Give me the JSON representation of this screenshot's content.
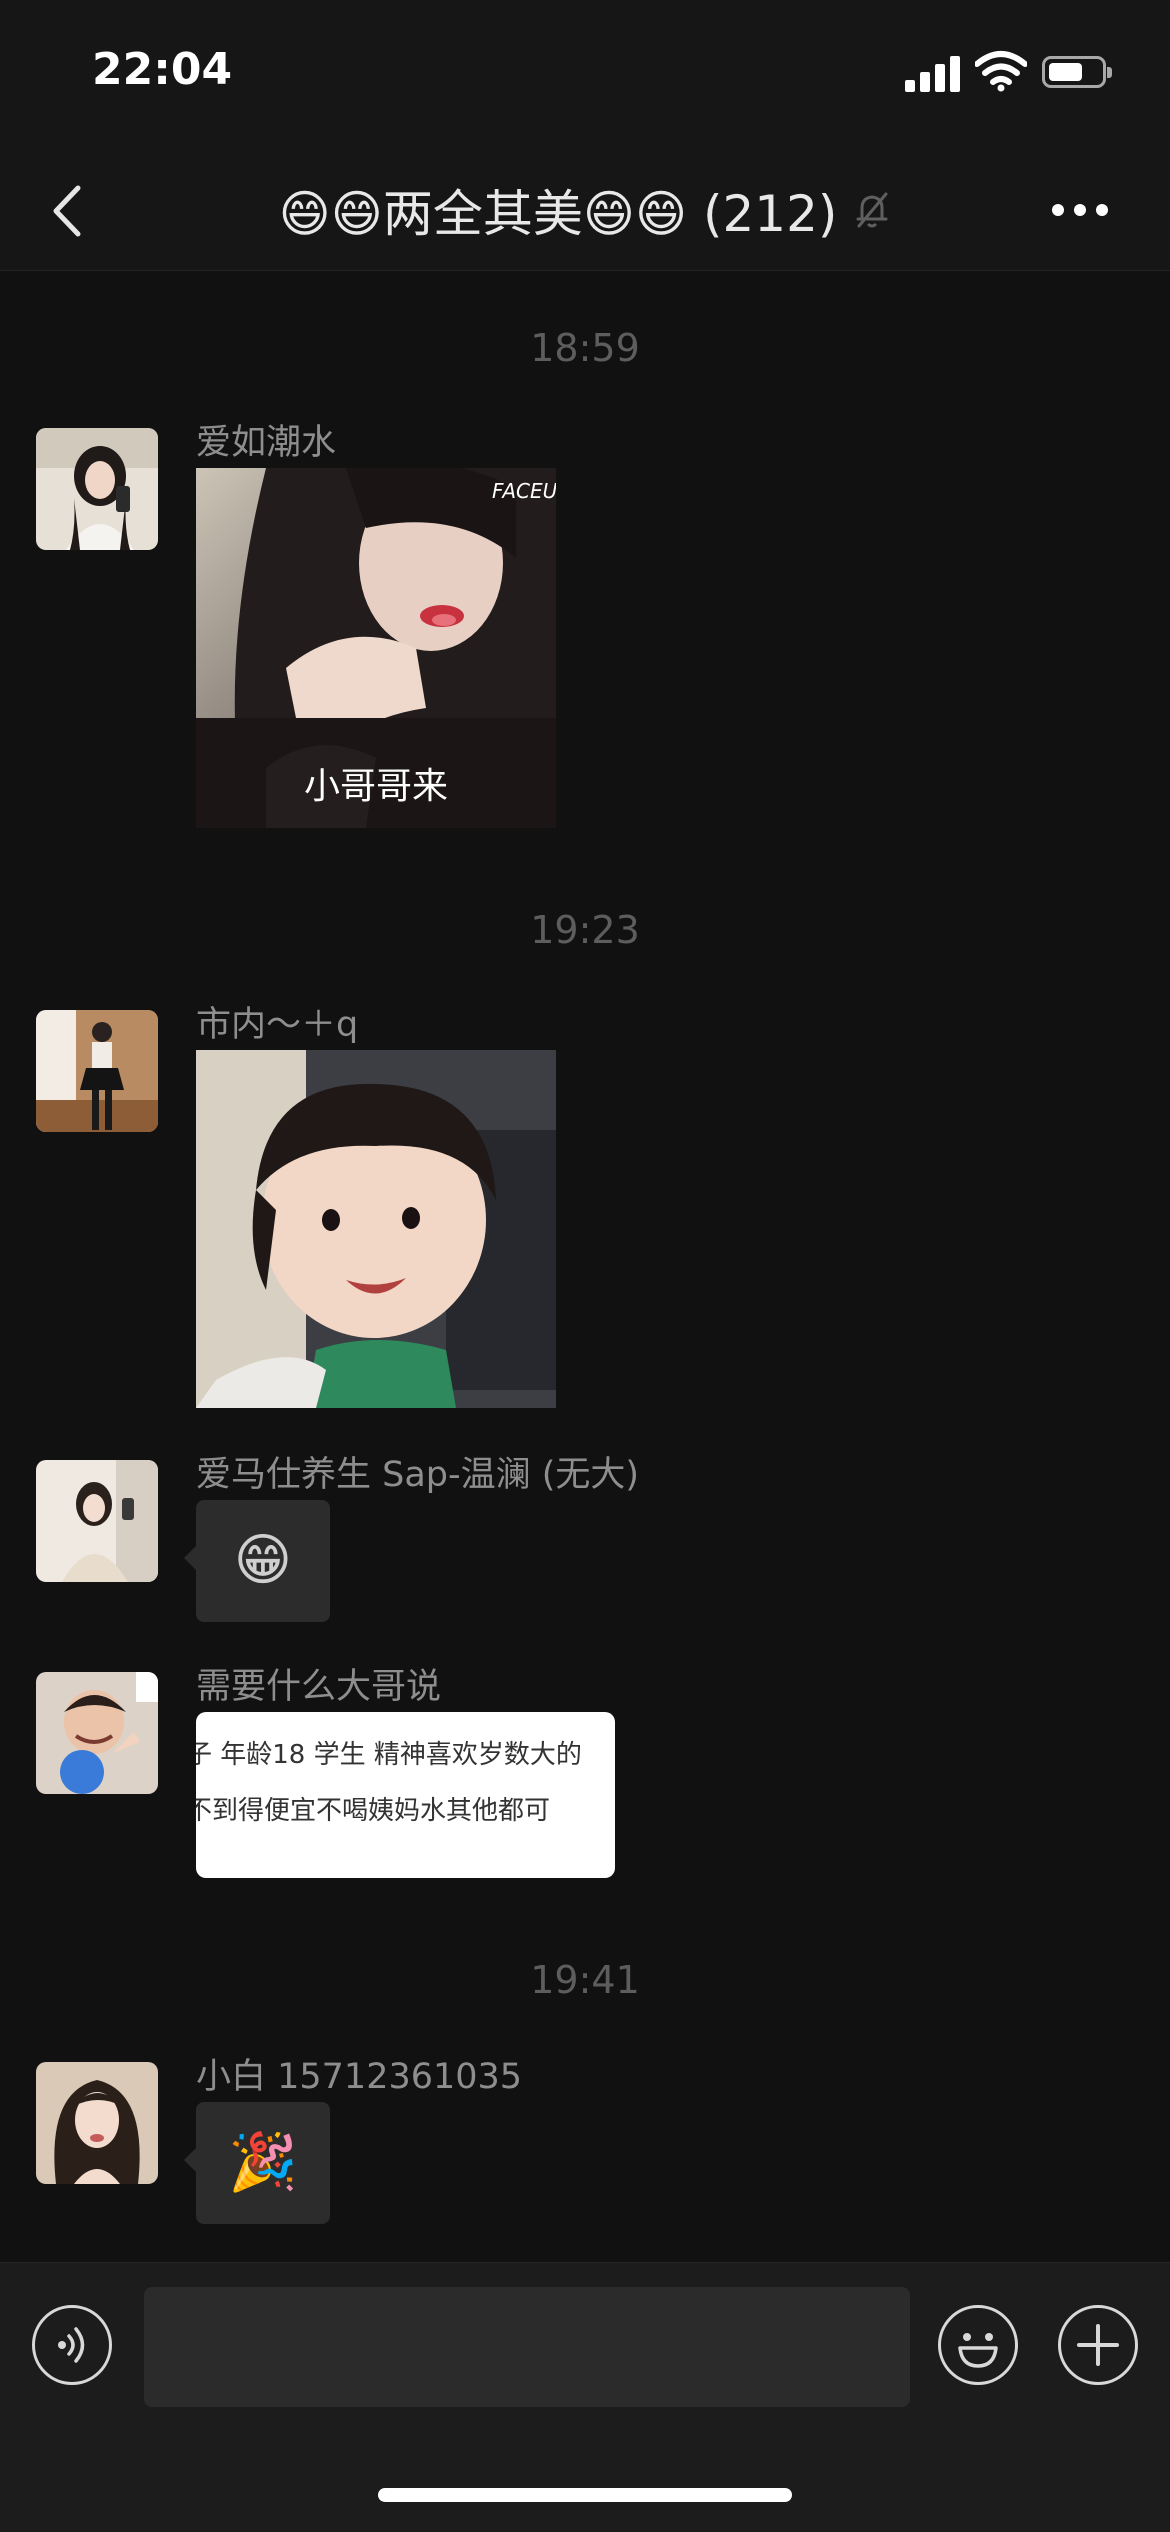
{
  "status_bar": {
    "time": "22:04",
    "icons": [
      "cellular-signal-icon",
      "wifi-icon",
      "battery-icon"
    ],
    "battery_level": 0.65
  },
  "nav": {
    "title": "😄😄两全其美😄😄 (212)",
    "muted_icon": "bell-off-icon",
    "back_icon": "chevron-left-icon",
    "more_icon": "ellipsis-icon"
  },
  "chat": {
    "timestamps": [
      "18:59",
      "19:23",
      "19:41"
    ],
    "messages": [
      {
        "sender": "爱如潮水",
        "type": "image",
        "caption": "小哥哥来",
        "watermark": "FACEU"
      },
      {
        "sender": "市内～＋q",
        "type": "image"
      },
      {
        "sender": "爱马仕养生 Sap-温澜 (无大)",
        "type": "emoji",
        "content": "😁"
      },
      {
        "sender": "需要什么大哥说",
        "type": "text-image",
        "lines": [
          "子 年龄18 学生 精神喜欢岁数大的",
          "不到得便宜不喝姨妈水其他都可"
        ]
      },
      {
        "sender": "小白 15712361035",
        "type": "emoji",
        "content": "🎉"
      }
    ]
  },
  "input_bar": {
    "voice_icon": "voice-icon",
    "emoji_icon": "smiley-icon",
    "plus_icon": "plus-icon",
    "text_value": ""
  },
  "colors": {
    "background": "#111111",
    "bar": "#161616",
    "bubble": "#2c2c2c",
    "timestamp": "#5d5d5d",
    "sender": "#8e8e8e"
  }
}
